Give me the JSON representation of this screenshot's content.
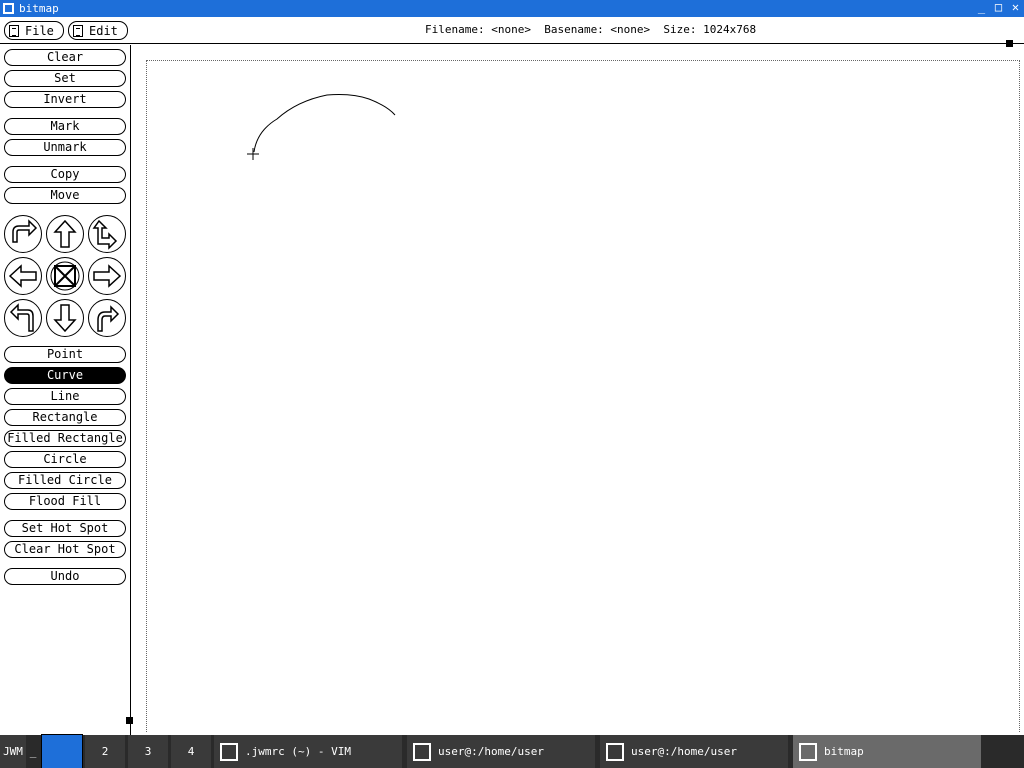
{
  "window": {
    "title": "bitmap",
    "controls": [
      "_",
      "□",
      "✕"
    ]
  },
  "menu": {
    "file": "File",
    "edit": "Edit",
    "info": "Filename: <none>  Basename: <none>  Size: 1024x768"
  },
  "tools": {
    "clear": "Clear",
    "set": "Set",
    "invert": "Invert",
    "mark": "Mark",
    "unmark": "Unmark",
    "copy": "Copy",
    "move": "Move",
    "point": "Point",
    "curve": "Curve",
    "line": "Line",
    "rectangle": "Rectangle",
    "filled_rectangle": "Filled Rectangle",
    "circle": "Circle",
    "filled_circle": "Filled Circle",
    "flood_fill": "Flood Fill",
    "set_hot_spot": "Set Hot Spot",
    "clear_hot_spot": "Clear Hot Spot",
    "undo": "Undo",
    "active_tool": "Curve"
  },
  "arrows": [
    "rotate-right-icon",
    "up-arrow-icon",
    "flip-vertical-icon",
    "left-arrow-icon",
    "fold-icon",
    "right-arrow-icon",
    "rotate-left-icon",
    "down-arrow-icon",
    "flip-horizontal-icon"
  ],
  "taskbar": {
    "jwm": "JWM",
    "min": "_",
    "desktops": [
      "",
      "2",
      "3",
      "4"
    ],
    "tasks": [
      ".jwmrc (~) - VIM",
      "user@:/home/user",
      "user@:/home/user",
      "bitmap"
    ],
    "active_task": "bitmap"
  },
  "colors": {
    "titlebar": "#1e6fd9",
    "taskbar": "#2a2a2a",
    "active_desktop": "#1e6fd9"
  }
}
